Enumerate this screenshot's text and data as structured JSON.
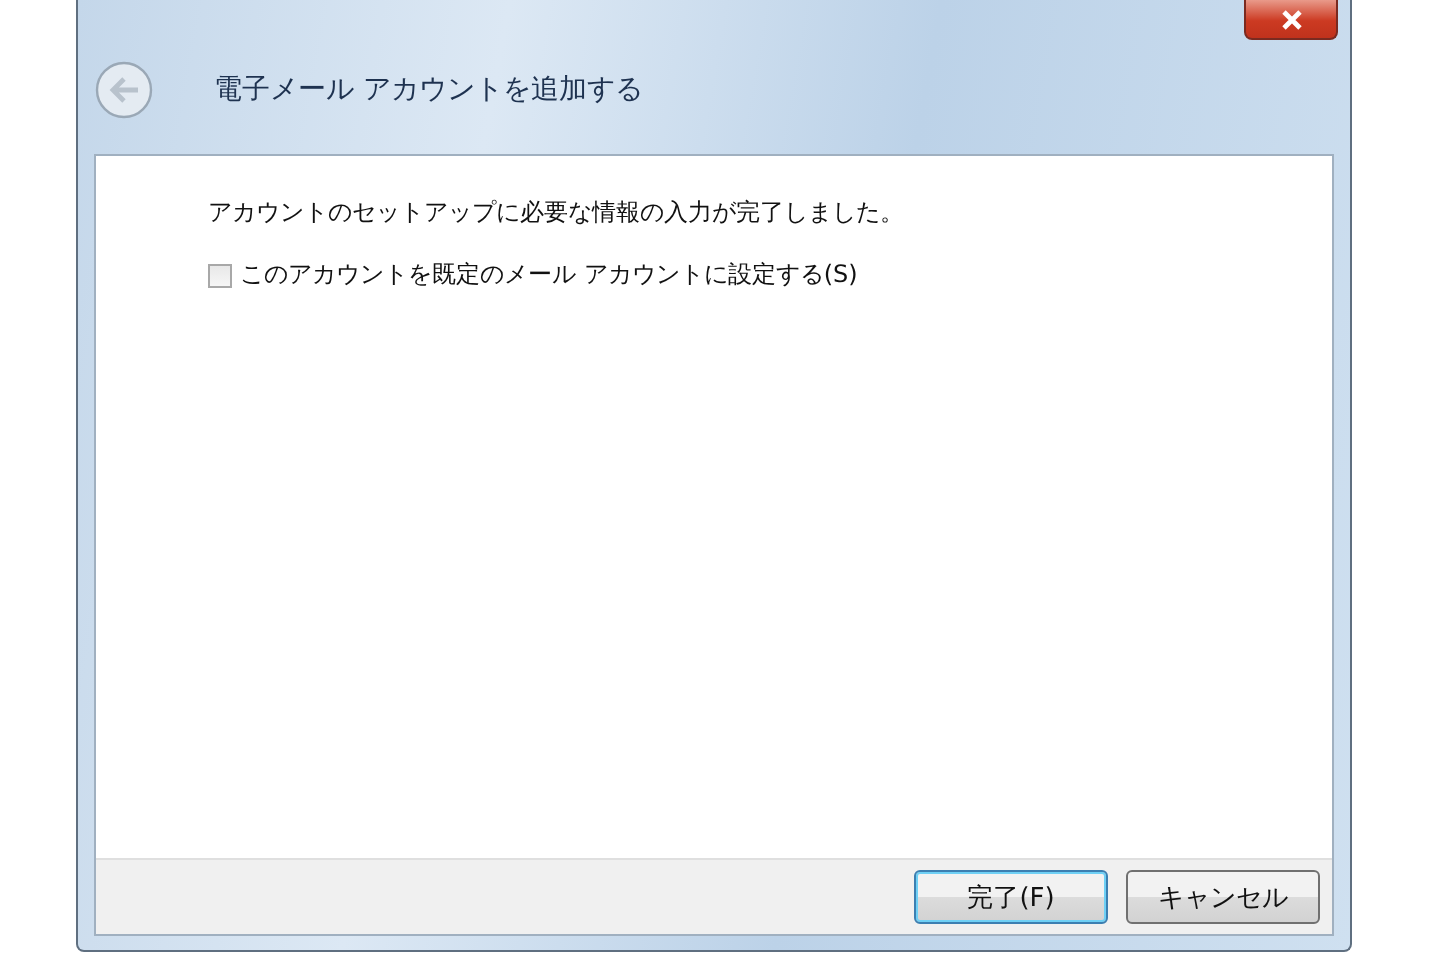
{
  "window": {
    "title": "電子メール アカウントを追加する",
    "back_disabled": true
  },
  "message": "アカウントのセットアップに必要な情報の入力が完了しました。",
  "checkbox": {
    "label": "このアカウントを既定のメール アカウントに設定する(S)",
    "checked": false
  },
  "buttons": [
    {
      "label": "完了(F)",
      "default": true
    },
    {
      "label": "キャンセル",
      "default": false
    }
  ]
}
